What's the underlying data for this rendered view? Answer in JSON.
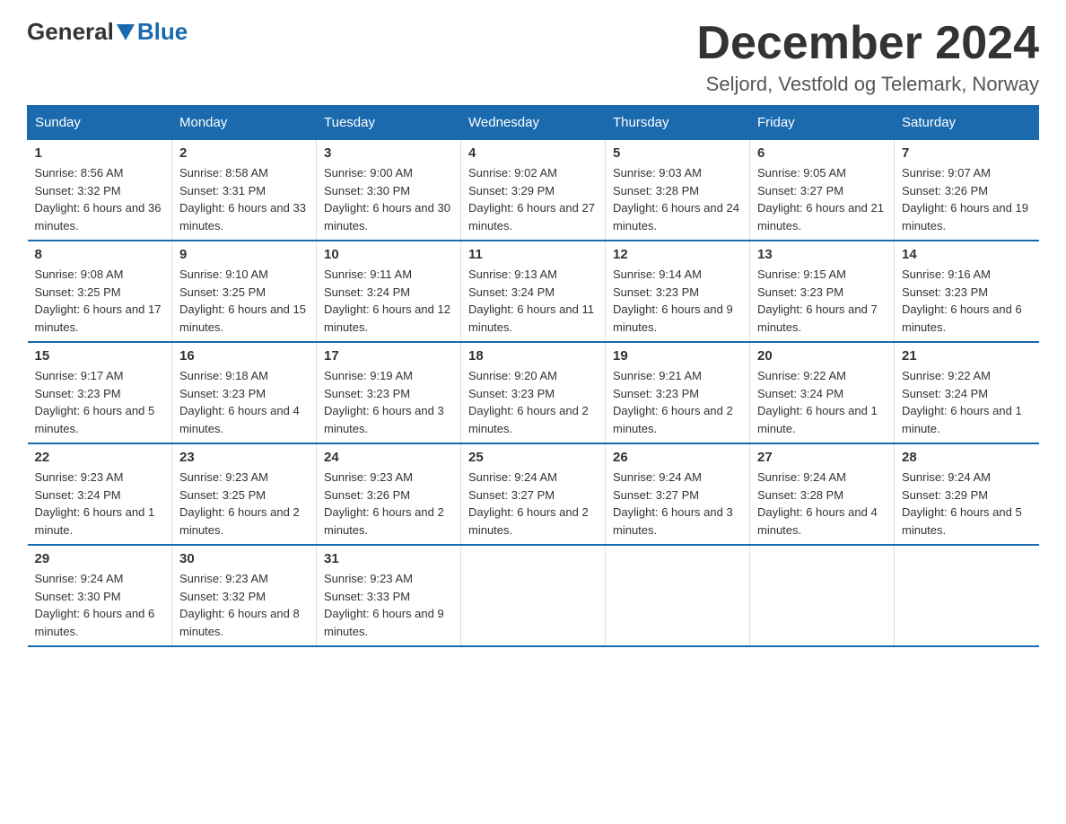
{
  "header": {
    "logo_general": "General",
    "logo_blue": "Blue",
    "title": "December 2024",
    "subtitle": "Seljord, Vestfold og Telemark, Norway"
  },
  "weekdays": [
    "Sunday",
    "Monday",
    "Tuesday",
    "Wednesday",
    "Thursday",
    "Friday",
    "Saturday"
  ],
  "weeks": [
    [
      {
        "day": "1",
        "sunrise": "8:56 AM",
        "sunset": "3:32 PM",
        "daylight": "6 hours and 36 minutes."
      },
      {
        "day": "2",
        "sunrise": "8:58 AM",
        "sunset": "3:31 PM",
        "daylight": "6 hours and 33 minutes."
      },
      {
        "day": "3",
        "sunrise": "9:00 AM",
        "sunset": "3:30 PM",
        "daylight": "6 hours and 30 minutes."
      },
      {
        "day": "4",
        "sunrise": "9:02 AM",
        "sunset": "3:29 PM",
        "daylight": "6 hours and 27 minutes."
      },
      {
        "day": "5",
        "sunrise": "9:03 AM",
        "sunset": "3:28 PM",
        "daylight": "6 hours and 24 minutes."
      },
      {
        "day": "6",
        "sunrise": "9:05 AM",
        "sunset": "3:27 PM",
        "daylight": "6 hours and 21 minutes."
      },
      {
        "day": "7",
        "sunrise": "9:07 AM",
        "sunset": "3:26 PM",
        "daylight": "6 hours and 19 minutes."
      }
    ],
    [
      {
        "day": "8",
        "sunrise": "9:08 AM",
        "sunset": "3:25 PM",
        "daylight": "6 hours and 17 minutes."
      },
      {
        "day": "9",
        "sunrise": "9:10 AM",
        "sunset": "3:25 PM",
        "daylight": "6 hours and 15 minutes."
      },
      {
        "day": "10",
        "sunrise": "9:11 AM",
        "sunset": "3:24 PM",
        "daylight": "6 hours and 12 minutes."
      },
      {
        "day": "11",
        "sunrise": "9:13 AM",
        "sunset": "3:24 PM",
        "daylight": "6 hours and 11 minutes."
      },
      {
        "day": "12",
        "sunrise": "9:14 AM",
        "sunset": "3:23 PM",
        "daylight": "6 hours and 9 minutes."
      },
      {
        "day": "13",
        "sunrise": "9:15 AM",
        "sunset": "3:23 PM",
        "daylight": "6 hours and 7 minutes."
      },
      {
        "day": "14",
        "sunrise": "9:16 AM",
        "sunset": "3:23 PM",
        "daylight": "6 hours and 6 minutes."
      }
    ],
    [
      {
        "day": "15",
        "sunrise": "9:17 AM",
        "sunset": "3:23 PM",
        "daylight": "6 hours and 5 minutes."
      },
      {
        "day": "16",
        "sunrise": "9:18 AM",
        "sunset": "3:23 PM",
        "daylight": "6 hours and 4 minutes."
      },
      {
        "day": "17",
        "sunrise": "9:19 AM",
        "sunset": "3:23 PM",
        "daylight": "6 hours and 3 minutes."
      },
      {
        "day": "18",
        "sunrise": "9:20 AM",
        "sunset": "3:23 PM",
        "daylight": "6 hours and 2 minutes."
      },
      {
        "day": "19",
        "sunrise": "9:21 AM",
        "sunset": "3:23 PM",
        "daylight": "6 hours and 2 minutes."
      },
      {
        "day": "20",
        "sunrise": "9:22 AM",
        "sunset": "3:24 PM",
        "daylight": "6 hours and 1 minute."
      },
      {
        "day": "21",
        "sunrise": "9:22 AM",
        "sunset": "3:24 PM",
        "daylight": "6 hours and 1 minute."
      }
    ],
    [
      {
        "day": "22",
        "sunrise": "9:23 AM",
        "sunset": "3:24 PM",
        "daylight": "6 hours and 1 minute."
      },
      {
        "day": "23",
        "sunrise": "9:23 AM",
        "sunset": "3:25 PM",
        "daylight": "6 hours and 2 minutes."
      },
      {
        "day": "24",
        "sunrise": "9:23 AM",
        "sunset": "3:26 PM",
        "daylight": "6 hours and 2 minutes."
      },
      {
        "day": "25",
        "sunrise": "9:24 AM",
        "sunset": "3:27 PM",
        "daylight": "6 hours and 2 minutes."
      },
      {
        "day": "26",
        "sunrise": "9:24 AM",
        "sunset": "3:27 PM",
        "daylight": "6 hours and 3 minutes."
      },
      {
        "day": "27",
        "sunrise": "9:24 AM",
        "sunset": "3:28 PM",
        "daylight": "6 hours and 4 minutes."
      },
      {
        "day": "28",
        "sunrise": "9:24 AM",
        "sunset": "3:29 PM",
        "daylight": "6 hours and 5 minutes."
      }
    ],
    [
      {
        "day": "29",
        "sunrise": "9:24 AM",
        "sunset": "3:30 PM",
        "daylight": "6 hours and 6 minutes."
      },
      {
        "day": "30",
        "sunrise": "9:23 AM",
        "sunset": "3:32 PM",
        "daylight": "6 hours and 8 minutes."
      },
      {
        "day": "31",
        "sunrise": "9:23 AM",
        "sunset": "3:33 PM",
        "daylight": "6 hours and 9 minutes."
      },
      null,
      null,
      null,
      null
    ]
  ],
  "labels": {
    "sunrise": "Sunrise:",
    "sunset": "Sunset:",
    "daylight": "Daylight:"
  }
}
